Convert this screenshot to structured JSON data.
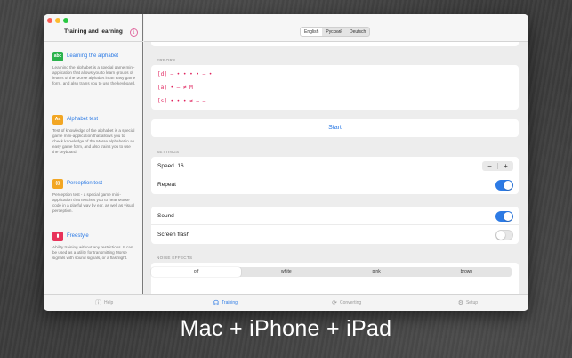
{
  "sidebar": {
    "title": "Training and learning",
    "info_glyph": "i",
    "items": [
      {
        "icon_text": "abc",
        "icon_color": "#2bb24c",
        "label": "Learning the alphabet",
        "description": "Learning the alphabet is a special game mini-application that allows you to learn groups of letters of the Morse alphabet in an easy game form, and also trains you to use the keyboard."
      },
      {
        "icon_text": "Aa",
        "icon_color": "#f2a623",
        "label": "Alphabet test",
        "description": "Test of knowledge of the alphabet is a special game mini-application that allows you to check knowledge of the Morse alphabet in an easy game form, and also trains you to use the keyboard."
      },
      {
        "icon_text": "(((",
        "icon_color": "#f2a623",
        "label": "Perception test",
        "description": "Perception test - a special game mini-application that teaches you to hear Morse code in a playful way by ear, as well as visual perception."
      },
      {
        "icon_text": "▮",
        "icon_color": "#e8335a",
        "label": "Freestyle",
        "description": "Ability training without any restrictions. It can be used as a utility for transmitting Morse signals with sound signals, or a flashlight."
      }
    ]
  },
  "header": {
    "languages": [
      "English",
      "Русский",
      "Deutsch"
    ],
    "selected_language": "English",
    "info_glyph": "i",
    "star_glyph": "☆"
  },
  "errors": {
    "label": "ERRORS",
    "lines": [
      "[d] — • • • • — •",
      "[a] • — ≠ M",
      "[s] • • • ≠ — —"
    ]
  },
  "start_label": "Start",
  "settings": {
    "label": "SETTINGS",
    "speed_label": "Speed",
    "speed_value": "16",
    "minus": "−",
    "plus": "+",
    "repeat_label": "Repeat",
    "repeat_on": true,
    "sound_label": "Sound",
    "sound_on": true,
    "flash_label": "Screen flash",
    "flash_on": false
  },
  "noise": {
    "label": "NOISE EFFECTS",
    "options": [
      "off",
      "white",
      "pink",
      "brown"
    ],
    "selected": "off"
  },
  "tabs": [
    {
      "label": "Help",
      "icon": "help-icon",
      "glyph": "ⓘ",
      "selected": false
    },
    {
      "label": "Training",
      "icon": "headphones-icon",
      "glyph": "☊",
      "selected": true
    },
    {
      "label": "Converting",
      "icon": "refresh-icon",
      "glyph": "⟳",
      "selected": false
    },
    {
      "label": "Setup",
      "icon": "gear-icon",
      "glyph": "⚙",
      "selected": false
    }
  ],
  "tagline": "Mac + iPhone + iPad",
  "colors": {
    "accent": "#2d7be5",
    "pink": "#e06aa0",
    "error": "#e0245e"
  }
}
